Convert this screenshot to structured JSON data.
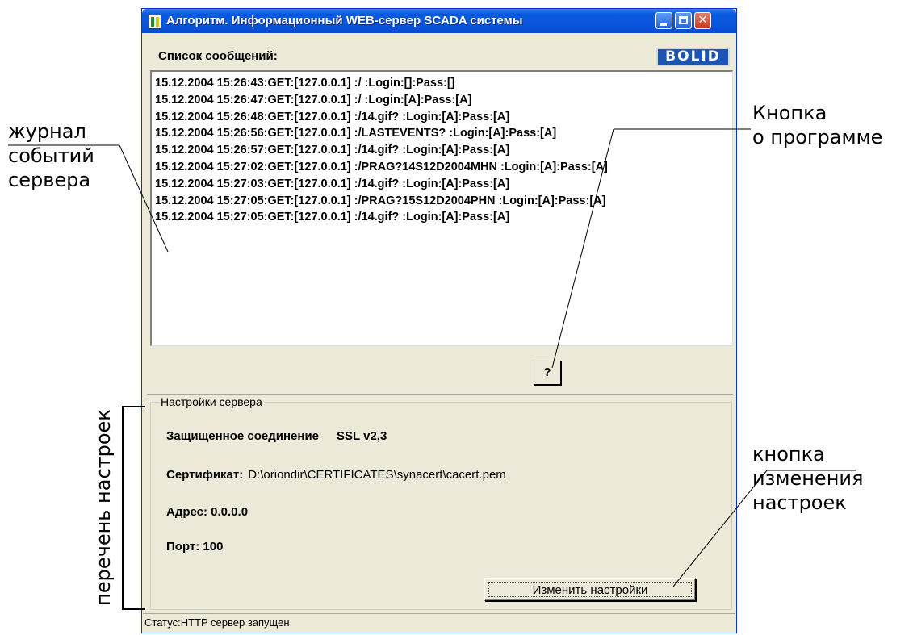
{
  "window": {
    "title": "Алгоритм. Информационный WEB-сервер SCADA системы",
    "logo_text": "BOLID"
  },
  "messages": {
    "label": "Список сообщений:",
    "lines": [
      "15.12.2004 15:26:43:GET:[127.0.0.1] :/ :Login:[]:Pass:[]",
      "15.12.2004 15:26:47:GET:[127.0.0.1] :/ :Login:[A]:Pass:[A]",
      "15.12.2004 15:26:48:GET:[127.0.0.1] :/14.gif? :Login:[A]:Pass:[A]",
      "15.12.2004 15:26:56:GET:[127.0.0.1] :/LASTEVENTS? :Login:[A]:Pass:[A]",
      "15.12.2004 15:26:57:GET:[127.0.0.1] :/14.gif? :Login:[A]:Pass:[A]",
      "15.12.2004 15:27:02:GET:[127.0.0.1] :/PRAG?14S12D2004MHN :Login:[A]:Pass:[A]",
      "15.12.2004 15:27:03:GET:[127.0.0.1] :/14.gif? :Login:[A]:Pass:[A]",
      "15.12.2004 15:27:05:GET:[127.0.0.1] :/PRAG?15S12D2004PHN :Login:[A]:Pass:[A]",
      "15.12.2004 15:27:05:GET:[127.0.0.1] :/14.gif? :Login:[A]:Pass:[A]"
    ]
  },
  "about_button": {
    "label": "?"
  },
  "settings": {
    "legend": "Настройки сервера",
    "ssl_label": "Защищенное соединение",
    "ssl_value": "SSL v2,3",
    "cert_label": "Сертификат:",
    "cert_value": "D:\\oriondir\\CERTIFICATES\\synacert\\cacert.pem",
    "address": "Адрес: 0.0.0.0",
    "port": "Порт: 100",
    "change_button": "Изменить настройки"
  },
  "status": {
    "text": "Статус:HTTP сервер запущен"
  },
  "annotations": {
    "journal": [
      "журнал",
      "событий",
      "сервера"
    ],
    "about": [
      "Кнопка",
      "о программе"
    ],
    "change": [
      "кнопка",
      "изменения",
      "настроек"
    ],
    "settings_list": "перечень настроек"
  }
}
